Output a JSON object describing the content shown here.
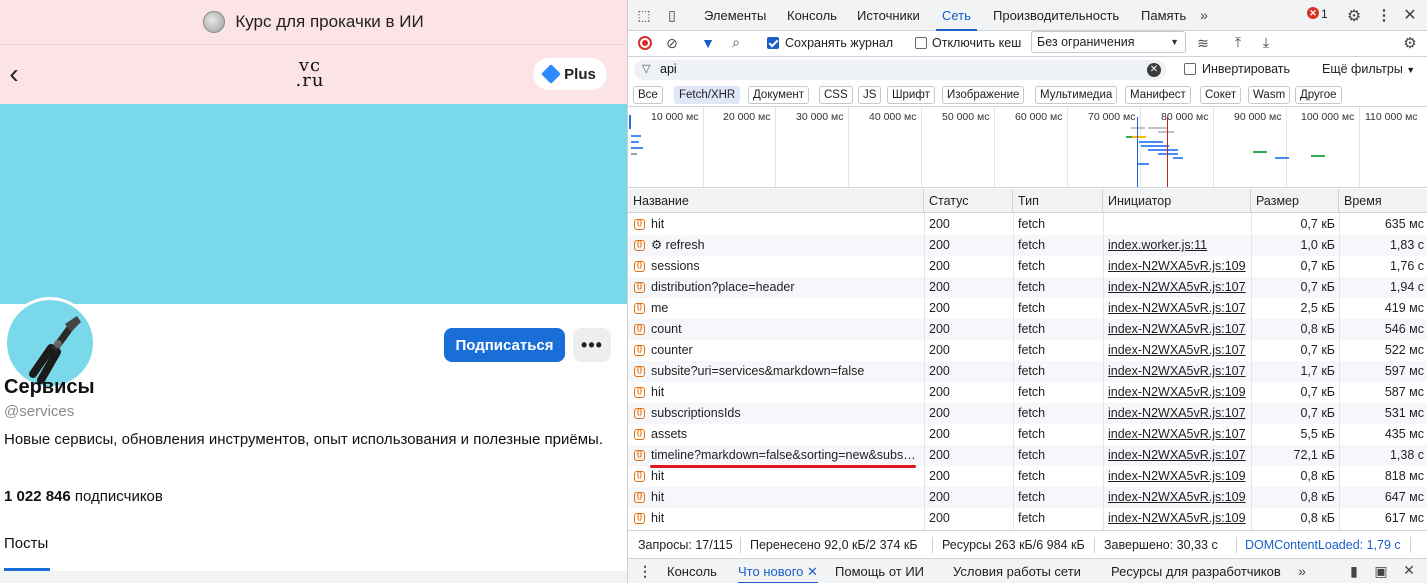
{
  "page": {
    "promo_text": "Курс для прокачки в ИИ",
    "logo_text_top": "vc",
    "logo_text_bottom": ".ru",
    "plus_label": "Plus",
    "subscribe_label": "Подписаться",
    "more_label": "•••",
    "channel_name": "Сервисы",
    "channel_handle": "@services",
    "channel_description": "Новые сервисы, обновления инструментов, опыт использования и полезные приёмы.",
    "subscribers_count": "1 022 846",
    "subscribers_word": "подписчиков",
    "posts_tab": "Посты",
    "colors": {
      "promo_bg": "#fbe3e6",
      "cover": "#79d8e9",
      "accent": "#1a6ed8"
    }
  },
  "devtools": {
    "tabs": [
      "Элементы",
      "Консоль",
      "Источники",
      "Сеть",
      "Производительность",
      "Память"
    ],
    "active_tab": "Сеть",
    "error_count": "1",
    "toolbar": {
      "preserve_log": "Сохранять журнал",
      "disable_cache": "Отключить кеш",
      "throttling": "Без ограничения"
    },
    "filter": {
      "value": "api",
      "invert": "Инвертировать",
      "more_filters": "Ещё фильтры"
    },
    "type_filters": [
      "Все",
      "Fetch/XHR",
      "Документ",
      "CSS",
      "JS",
      "Шрифт",
      "Изображение",
      "Мультимедиа",
      "Манифест",
      "Сокет",
      "Wasm",
      "Другое"
    ],
    "active_type": "Fetch/XHR",
    "overview_ticks": [
      "10 000 мс",
      "20 000 мс",
      "30 000 мс",
      "40 000 мс",
      "50 000 мс",
      "60 000 мс",
      "70 000 мс",
      "80 000 мс",
      "90 000 мс",
      "100 000 мс",
      "110 000 мс"
    ],
    "columns": [
      "Название",
      "Статус",
      "Тип",
      "Инициатор",
      "Размер",
      "Время"
    ],
    "requests": [
      {
        "name": "hit",
        "status": "200",
        "type": "fetch",
        "initiator": "",
        "size": "0,7 кБ",
        "time": "635 мс"
      },
      {
        "name": "⚙ refresh",
        "status": "200",
        "type": "fetch",
        "initiator": "index.worker.js:11",
        "size": "1,0 кБ",
        "time": "1,83 с"
      },
      {
        "name": "sessions",
        "status": "200",
        "type": "fetch",
        "initiator": "index-N2WXA5vR.js:109",
        "size": "0,7 кБ",
        "time": "1,76 с"
      },
      {
        "name": "distribution?place=header",
        "status": "200",
        "type": "fetch",
        "initiator": "index-N2WXA5vR.js:107",
        "size": "0,7 кБ",
        "time": "1,94 с"
      },
      {
        "name": "me",
        "status": "200",
        "type": "fetch",
        "initiator": "index-N2WXA5vR.js:107",
        "size": "2,5 кБ",
        "time": "419 мс"
      },
      {
        "name": "count",
        "status": "200",
        "type": "fetch",
        "initiator": "index-N2WXA5vR.js:107",
        "size": "0,8 кБ",
        "time": "546 мс"
      },
      {
        "name": "counter",
        "status": "200",
        "type": "fetch",
        "initiator": "index-N2WXA5vR.js:107",
        "size": "0,7 кБ",
        "time": "522 мс"
      },
      {
        "name": "subsite?uri=services&markdown=false",
        "status": "200",
        "type": "fetch",
        "initiator": "index-N2WXA5vR.js:107",
        "size": "1,7 кБ",
        "time": "597 мс"
      },
      {
        "name": "hit",
        "status": "200",
        "type": "fetch",
        "initiator": "index-N2WXA5vR.js:109",
        "size": "0,7 кБ",
        "time": "587 мс"
      },
      {
        "name": "subscriptionsIds",
        "status": "200",
        "type": "fetch",
        "initiator": "index-N2WXA5vR.js:107",
        "size": "0,7 кБ",
        "time": "531 мс"
      },
      {
        "name": "assets",
        "status": "200",
        "type": "fetch",
        "initiator": "index-N2WXA5vR.js:107",
        "size": "5,5 кБ",
        "time": "435 мс"
      },
      {
        "name": "timeline?markdown=false&sorting=new&subs…",
        "status": "200",
        "type": "fetch",
        "initiator": "index-N2WXA5vR.js:107",
        "size": "72,1 кБ",
        "time": "1,38 с"
      },
      {
        "name": "hit",
        "status": "200",
        "type": "fetch",
        "initiator": "index-N2WXA5vR.js:109",
        "size": "0,8 кБ",
        "time": "818 мс"
      },
      {
        "name": "hit",
        "status": "200",
        "type": "fetch",
        "initiator": "index-N2WXA5vR.js:109",
        "size": "0,8 кБ",
        "time": "647 мс"
      },
      {
        "name": "hit",
        "status": "200",
        "type": "fetch",
        "initiator": "index-N2WXA5vR.js:109",
        "size": "0,8 кБ",
        "time": "617 мс"
      }
    ],
    "status_bar": {
      "requests": "Запросы: 17/115",
      "transferred": "Перенесено 92,0 кБ/2 374 кБ",
      "resources": "Ресурсы 263 кБ/6 984 кБ",
      "finished": "Завершено: 30,33 с",
      "dom_loaded": "DOMContentLoaded: 1,79 с"
    },
    "drawer_tabs": [
      "Консоль",
      "Что нового",
      "Помощь от ИИ",
      "Условия работы сети",
      "Ресурсы для разработчиков"
    ],
    "active_drawer_tab": "Что нового",
    "colors": {
      "accent": "#1a5fc8",
      "highlight_underline": "#e0181b"
    }
  }
}
